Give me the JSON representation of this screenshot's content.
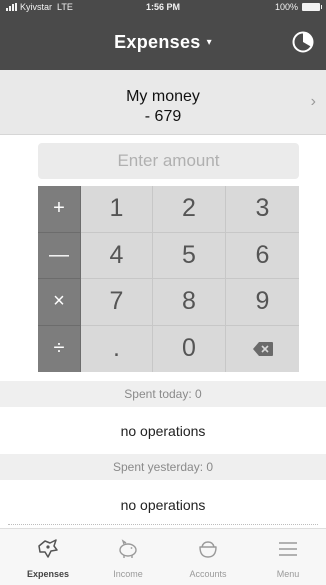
{
  "status_bar": {
    "carrier": "Kyivstar",
    "network": "LTE",
    "time": "1:56 PM",
    "battery": "100%"
  },
  "nav": {
    "title": "Expenses",
    "caret": "▾",
    "chart_icon": "pie-chart-icon"
  },
  "account": {
    "name": "My money",
    "amount": "- 679",
    "chevron": "›"
  },
  "amount_input": {
    "placeholder": "Enter amount",
    "value": ""
  },
  "keypad": {
    "plus": "+",
    "minus": "—",
    "multiply": "×",
    "divide": "÷",
    "k1": "1",
    "k2": "2",
    "k3": "3",
    "k4": "4",
    "k5": "5",
    "k6": "6",
    "k7": "7",
    "k8": "8",
    "k9": "9",
    "dot": ".",
    "k0": "0",
    "backspace_icon": "backspace-icon"
  },
  "today": {
    "header": "Spent today: 0",
    "empty": "no operations"
  },
  "yesterday": {
    "header": "Spent yesterday: 0",
    "empty": "no operations"
  },
  "tabs": [
    {
      "label": "Expenses",
      "icon": "expenses-icon",
      "active": true
    },
    {
      "label": "Income",
      "icon": "piggy-bank-icon",
      "active": false
    },
    {
      "label": "Accounts",
      "icon": "wallet-icon",
      "active": false
    },
    {
      "label": "Menu",
      "icon": "menu-icon",
      "active": false
    }
  ]
}
